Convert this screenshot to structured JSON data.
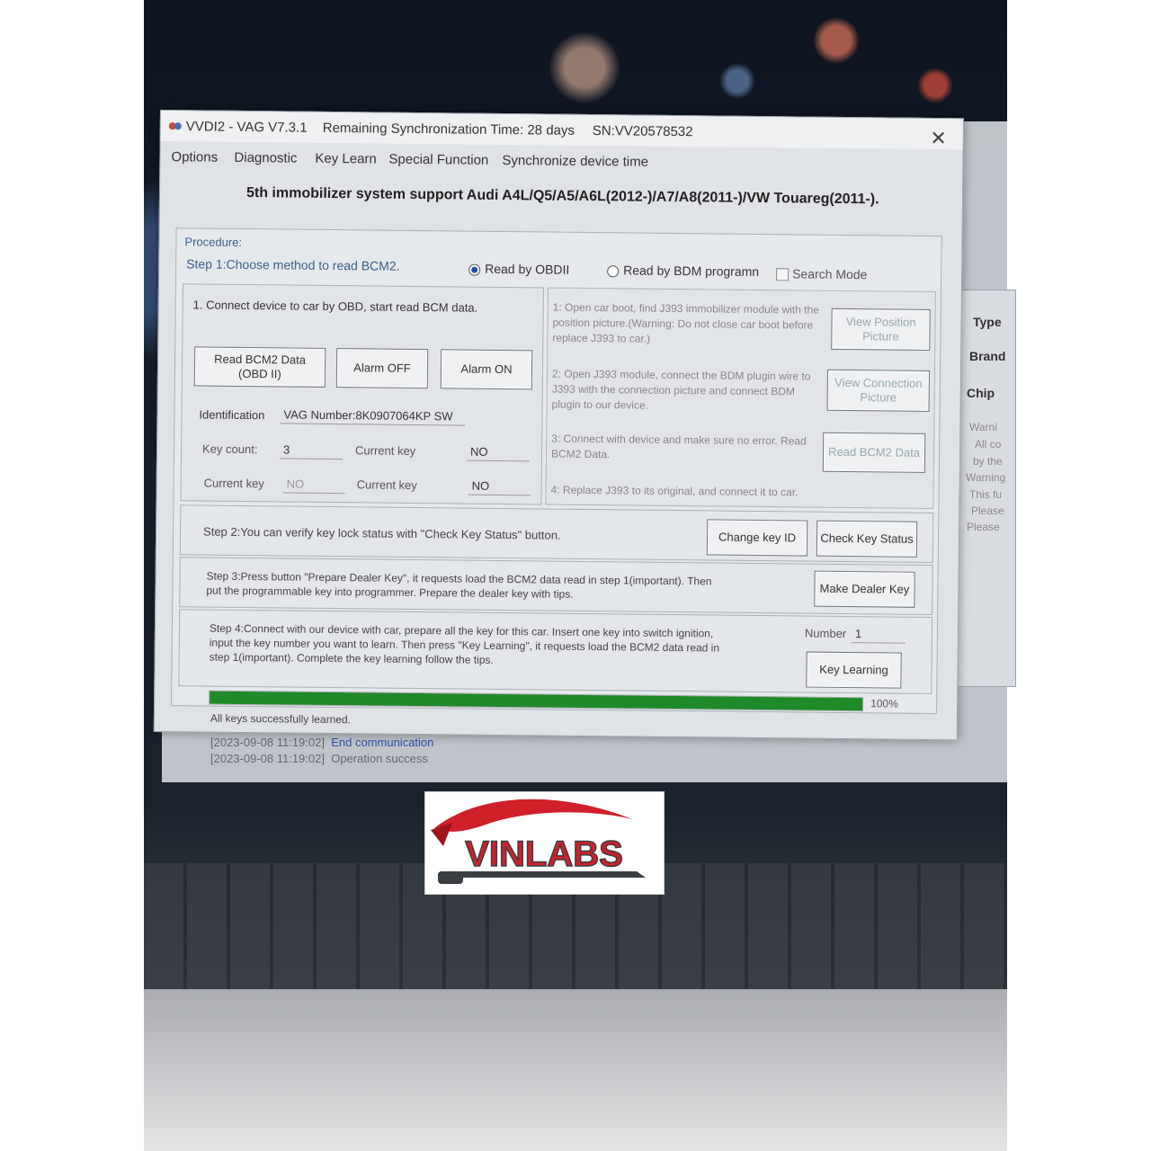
{
  "window": {
    "title": "VVDI2 - VAG V7.3.1",
    "sync_time": "Remaining Synchronization Time: 28 days",
    "serial": "SN:VV20578532",
    "close_glyph": "✕"
  },
  "menu": [
    "Options",
    "Diagnostic",
    "Key Learn",
    "Special Function",
    "Synchronize device time"
  ],
  "headline": "5th immobilizer system support Audi A4L/Q5/A5/A6L(2012-)/A7/A8(2011-)/VW Touareg(2011-).",
  "procedure": {
    "label": "Procedure:",
    "step1": "Step 1:Choose method to read BCM2.",
    "radio_obd": "Read by OBDII",
    "radio_bdm": "Read by BDM programn",
    "search_mode": "Search Mode",
    "selected": "Read by OBDII"
  },
  "obd_panel": {
    "instruction": "1. Connect device to car by OBD, start read BCM data.",
    "read_btn_line1": "Read BCM2 Data",
    "read_btn_line2": "(OBD II)",
    "alarm_off": "Alarm OFF",
    "alarm_on": "Alarm ON",
    "identification_label": "Identification",
    "identification_value": "VAG Number:8K0907064KP  SW",
    "key_count_label": "Key count:",
    "key_count_value": "3",
    "current_key_label_a": "Current key",
    "current_key_value_a": "NO",
    "current_key_label_b": "Current key",
    "current_key_value_b": "NO",
    "current_key_label_c": "Current key",
    "current_key_value_c": "NO"
  },
  "bdm_panel": {
    "step1": "1: Open car boot, find J393 immobilizer module with the position picture.(Warning: Do not close car boot before replace J393 to car.)",
    "view_position": "View Position Picture",
    "step2": "2: Open J393 module, connect the BDM plugin wire to J393 with the connection picture and connect BDM plugin to our device.",
    "view_connection": "View Connection Picture",
    "step3": "3: Connect with device and make sure no error. Read BCM2 Data.",
    "read_bcm2": "Read BCM2 Data",
    "step4": "4: Replace J393 to its original, and connect it to car."
  },
  "step2": {
    "text": "Step 2:You can verify key lock status with \"Check Key Status\" button.",
    "change_key": "Change key ID",
    "check_key": "Check Key Status"
  },
  "step3": {
    "text_line1": "Step 3:Press button \"Prepare Dealer Key\", it requests load the BCM2 data read in step 1(important). Then",
    "text_line2": "put the programmable key into programmer. Prepare the dealer key with tips.",
    "make_dealer": "Make Dealer Key"
  },
  "step4": {
    "text_line1": "Step 4:Connect with our device with car, prepare all the key for this car. Insert one key into switch ignition,",
    "text_line2": "input the key number you want to learn. Then press \"Key Learning\",  it requests load the BCM2 data read in",
    "text_line3": "step 1(important). Complete the key learning follow the tips.",
    "number_label": "Number",
    "number_value": "1",
    "key_learning": "Key Learning"
  },
  "progress": {
    "percent": 100,
    "percent_label": "100%",
    "status": "All keys successfully learned."
  },
  "log": [
    {
      "time": "[2023-09-08 11:19:02]",
      "msg": "End communication",
      "color": "#2a52b0"
    },
    {
      "time": "[2023-09-08 11:19:02]",
      "msg": "Operation success",
      "color": "#667788"
    }
  ],
  "side_panel": {
    "type": "Type",
    "brand": "Brand",
    "chip": "Chip",
    "warn1": "Warni",
    "warn2": "All co",
    "warn3": "by the",
    "warn4": "Warning",
    "warn5": "This fu",
    "warn6": "Please",
    "warn7": "Please"
  },
  "logo": {
    "text": "VINLABS",
    "colors": {
      "red": "#d0202a",
      "dark": "#3a3d42"
    }
  },
  "colors": {
    "progress": "#1f8a2a",
    "radio_selected": "#1e4fa8"
  }
}
